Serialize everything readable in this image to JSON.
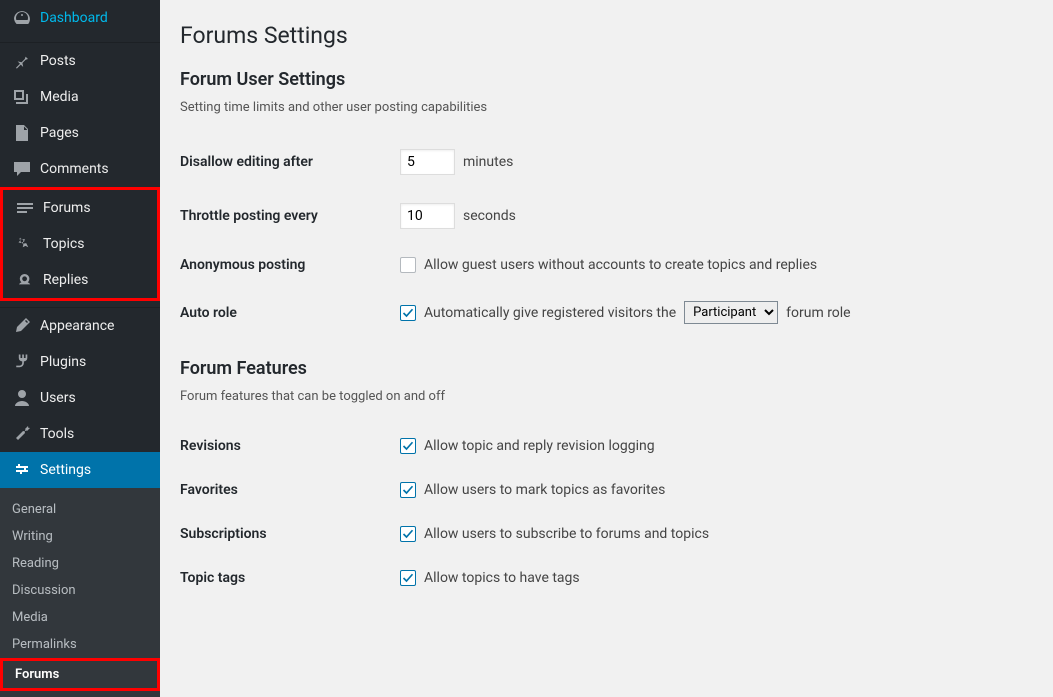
{
  "sidebar": {
    "dashboard": "Dashboard",
    "posts": "Posts",
    "media": "Media",
    "pages": "Pages",
    "comments": "Comments",
    "forums": "Forums",
    "topics": "Topics",
    "replies": "Replies",
    "appearance": "Appearance",
    "plugins": "Plugins",
    "users": "Users",
    "tools": "Tools",
    "settings": "Settings",
    "submenu": {
      "general": "General",
      "writing": "Writing",
      "reading": "Reading",
      "discussion": "Discussion",
      "media": "Media",
      "permalinks": "Permalinks",
      "forums": "Forums"
    }
  },
  "page": {
    "title": "Forums Settings",
    "userSettings": {
      "heading": "Forum User Settings",
      "desc": "Setting time limits and other user posting capabilities",
      "disallowEditing": {
        "label": "Disallow editing after",
        "value": "5",
        "unit": "minutes"
      },
      "throttle": {
        "label": "Throttle posting every",
        "value": "10",
        "unit": "seconds"
      },
      "anonymous": {
        "label": "Anonymous posting",
        "text": "Allow guest users without accounts to create topics and replies"
      },
      "autoRole": {
        "label": "Auto role",
        "textBefore": "Automatically give registered visitors the",
        "selected": "Participant",
        "textAfter": "forum role"
      }
    },
    "features": {
      "heading": "Forum Features",
      "desc": "Forum features that can be toggled on and off",
      "revisions": {
        "label": "Revisions",
        "text": "Allow topic and reply revision logging"
      },
      "favorites": {
        "label": "Favorites",
        "text": "Allow users to mark topics as favorites"
      },
      "subscriptions": {
        "label": "Subscriptions",
        "text": "Allow users to subscribe to forums and topics"
      },
      "topicTags": {
        "label": "Topic tags",
        "text": "Allow topics to have tags"
      }
    }
  }
}
